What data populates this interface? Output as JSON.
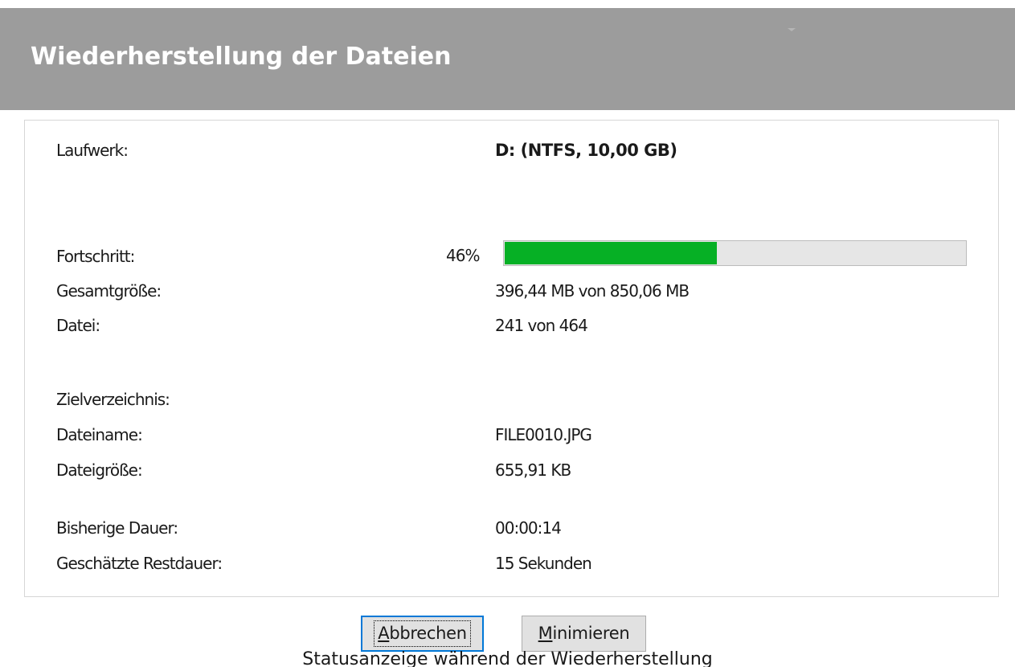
{
  "dialog": {
    "title": "Wiederherstellung der Dateien"
  },
  "fields": {
    "drive_label": "Laufwerk:",
    "drive_value": "D: (NTFS, 10,00 GB)",
    "progress_label": "Fortschritt:",
    "progress_percent_text": "46%",
    "progress_fraction": 0.46,
    "total_size_label": "Gesamtgröße:",
    "total_size_value": "396,44 MB von 850,06 MB",
    "file_label": "Datei:",
    "file_value": "241 von 464",
    "target_dir_label": "Zielverzeichnis:",
    "filename_label": "Dateiname:",
    "filename_value": "FILE0010.JPG",
    "filesize_label": "Dateigröße:",
    "filesize_value": "655,91 KB",
    "elapsed_label": "Bisherige Dauer:",
    "elapsed_value": "00:00:14",
    "remaining_label": "Geschätzte Restdauer:",
    "remaining_value": "15 Sekunden"
  },
  "buttons": {
    "cancel_accel": "A",
    "cancel_rest": "bbrechen",
    "minimize_accel": "M",
    "minimize_rest": "inimieren"
  },
  "caption": "Statusanzeige während der Wiederherstellung",
  "colors": {
    "header_bg": "#9c9c9c",
    "progress_fill": "#06b025",
    "focus_border": "#0078d7"
  }
}
